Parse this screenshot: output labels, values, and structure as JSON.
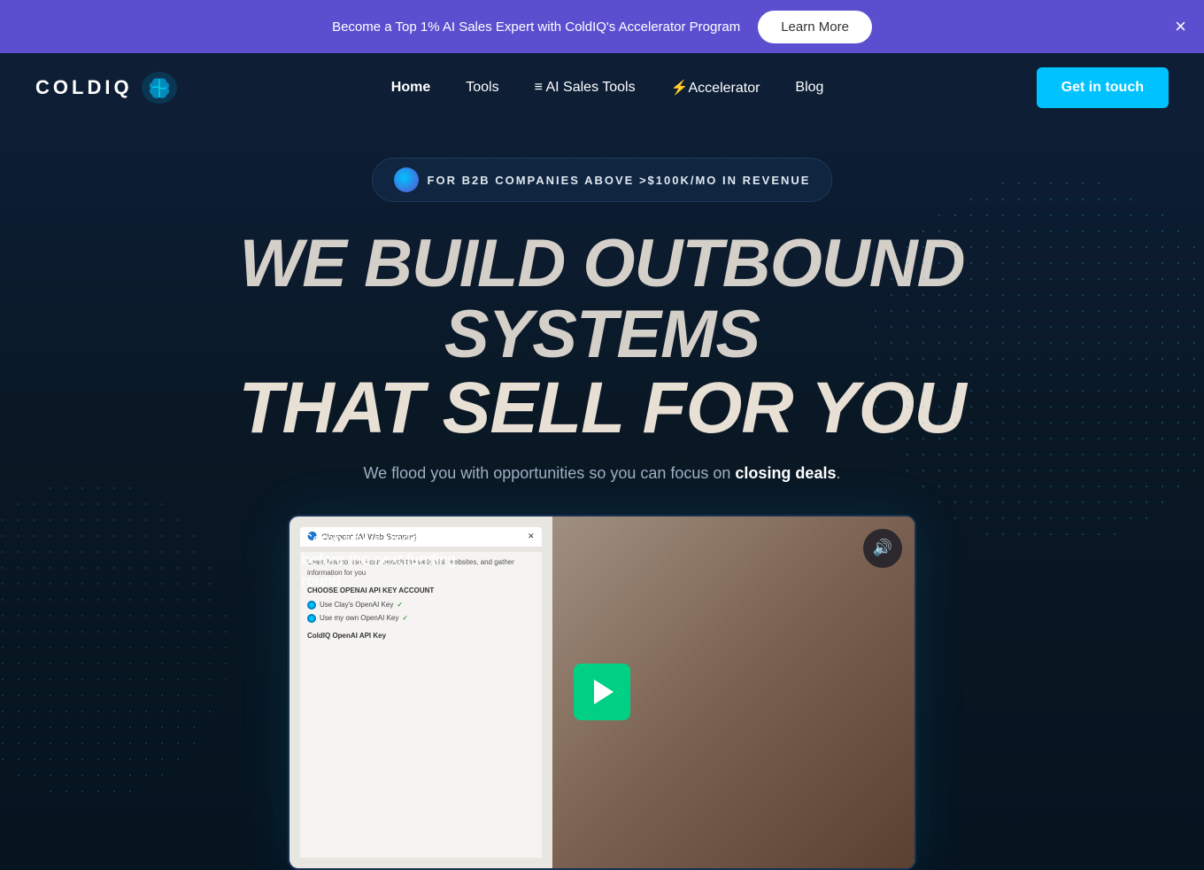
{
  "banner": {
    "text": "Become a Top 1% AI Sales Expert with ColdIQ's Accelerator Program",
    "cta_label": "Learn More",
    "close_label": "×"
  },
  "nav": {
    "logo_text": "COLDIQ",
    "links": [
      {
        "id": "home",
        "label": "Home",
        "active": true,
        "icon": ""
      },
      {
        "id": "tools",
        "label": "Tools",
        "active": false,
        "icon": ""
      },
      {
        "id": "ai-sales-tools",
        "label": "AI Sales Tools",
        "active": false,
        "icon": "≡ "
      },
      {
        "id": "accelerator",
        "label": "Accelerator",
        "active": false,
        "icon": "⚡"
      },
      {
        "id": "blog",
        "label": "Blog",
        "active": false,
        "icon": ""
      }
    ],
    "cta_label": "Get in touch"
  },
  "hero": {
    "badge_text": "FOR B2B COMPANIES ABOVE >$100K/MO IN REVENUE",
    "headline_line1": "WE BUILD OUTBOUND SYSTEMS",
    "headline_line2": "THAT SELL FOR YOU",
    "subtext": "We flood you with opportunities so you can focus on ",
    "subtext_bold": "closing deals",
    "subtext_end": ".",
    "video": {
      "text_line1": "Company is under pressure",
      "text_line2": "before the next funding round",
      "app_title": "Claygent (AI Web Scraper)",
      "app_description": "Learn how to use: I can search the web, visit websites, and gather information for you",
      "section_label": "CHOOSE OPENAI API KEY ACCOUNT",
      "option1": "Use Clay's OpenAI Key",
      "option2": "Use my own OpenAI Key",
      "section_label2": "ColdIQ OpenAI API Key"
    }
  }
}
